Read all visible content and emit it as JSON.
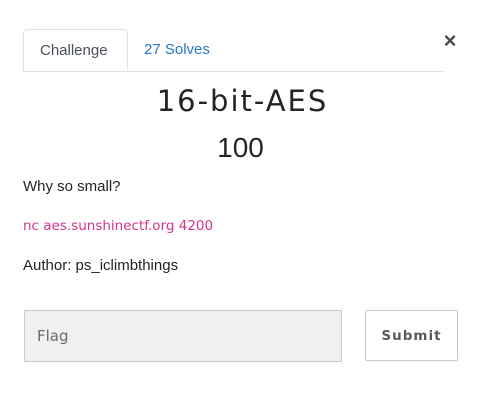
{
  "modal": {
    "close_symbol": "×",
    "tabs": [
      {
        "label": "Challenge",
        "active": true
      },
      {
        "label": "27 Solves",
        "active": false
      }
    ],
    "challenge": {
      "name": "16-bit-AES",
      "points": "100",
      "description_line": "Why so small?",
      "connection": "nc aes.sunshinectf.org 4200",
      "author": "Author: ps_iclimbthings"
    },
    "flag_input": {
      "value": "",
      "placeholder": "Flag"
    },
    "submit_label": "Submit"
  },
  "colors": {
    "link": "#2979c7",
    "code": "#d6338e",
    "input_bg": "#f0f0f0"
  },
  "icons": {
    "close": "close-icon"
  }
}
